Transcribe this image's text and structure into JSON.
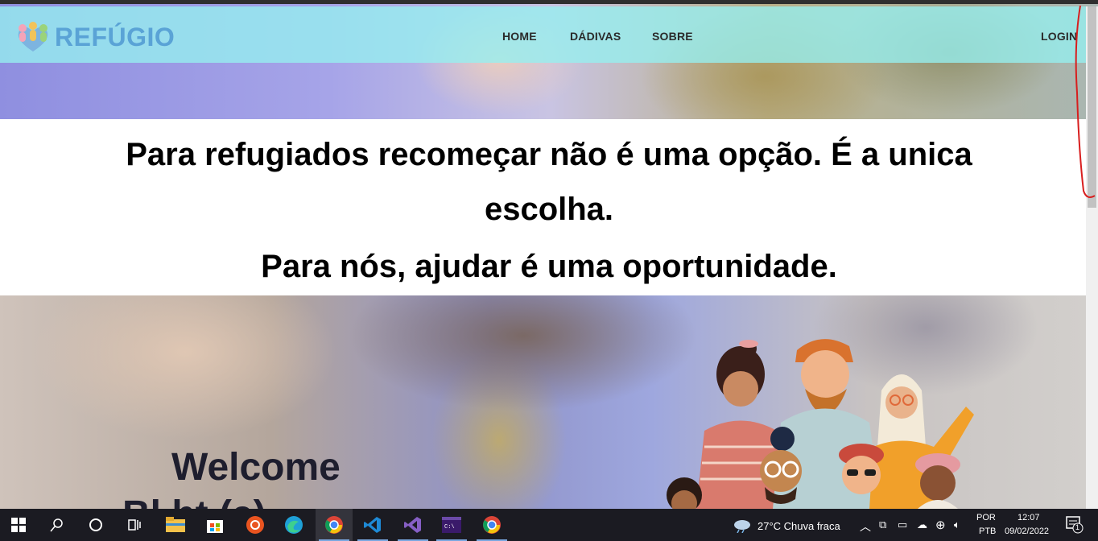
{
  "app": {
    "logo_text": "REFÚGIO"
  },
  "nav": {
    "items": [
      {
        "label": "HOME"
      },
      {
        "label": "DÁDIVAS"
      },
      {
        "label": "SOBRE"
      }
    ],
    "login_label": "LOGIN"
  },
  "hero": {
    "tagline_line1": "Para refugiados recomeçar não é uma opção. É a unica escolha.",
    "tagline_line2": "Para nós, ajudar é uma oportunidade."
  },
  "welcome": {
    "title": "Welcome",
    "subtitle_partial": "Bl       ht (a)"
  },
  "taskbar": {
    "weather": "27°C  Chuva fraca",
    "language_top": "POR",
    "language_bottom": "PTB",
    "time": "12:07",
    "date": "09/02/2022",
    "notification_count": "1"
  },
  "colors": {
    "navbar": "#96f0f0",
    "logo": "#5aa3d6",
    "taskbar": "#1b1b22"
  }
}
